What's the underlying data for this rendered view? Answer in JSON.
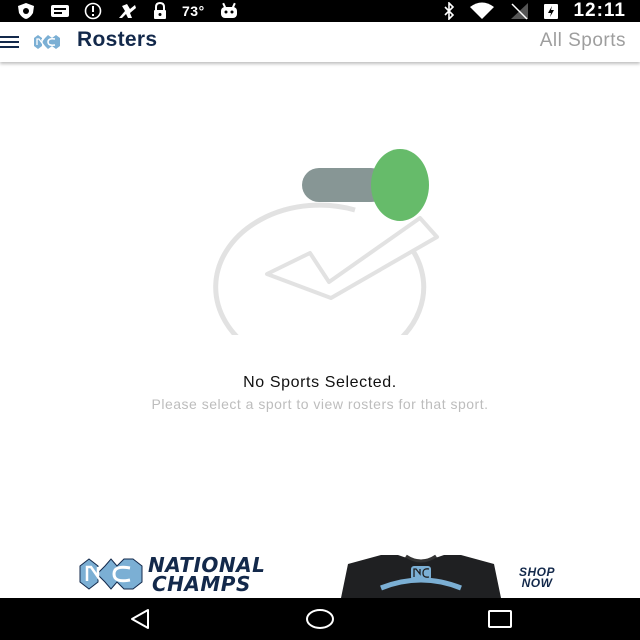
{
  "status_bar": {
    "temperature": "73°",
    "time": "12:11",
    "icons": [
      "shield-icon",
      "message-icon",
      "alert-icon",
      "fan-icon",
      "lock-icon",
      "android-icon",
      "bluetooth-icon",
      "wifi-icon",
      "no-signal-icon",
      "battery-charging-icon"
    ]
  },
  "app_bar": {
    "menu_icon": "hamburger-menu-icon",
    "logo_icon": "unc-nc-logo-icon",
    "title": "Rosters",
    "sport_selector": "All Sports"
  },
  "empty_state": {
    "illustration_icon": "toggle-checkmark-icon",
    "toggle_color": "#66bb6a",
    "title": "No Sports Selected.",
    "message": "Please select a sport to view rosters for that sport."
  },
  "ad_banner": {
    "logo_icon": "unc-nc-logo-icon",
    "headline_line1": "NATIONAL",
    "headline_line2": "CHAMPS",
    "cta_line1": "SHOP",
    "cta_line2": "NOW",
    "brand_color": "#13294b",
    "accent_color": "#7bafd4"
  },
  "nav_bar": {
    "icons": [
      "back-icon",
      "home-icon",
      "recents-icon"
    ]
  }
}
